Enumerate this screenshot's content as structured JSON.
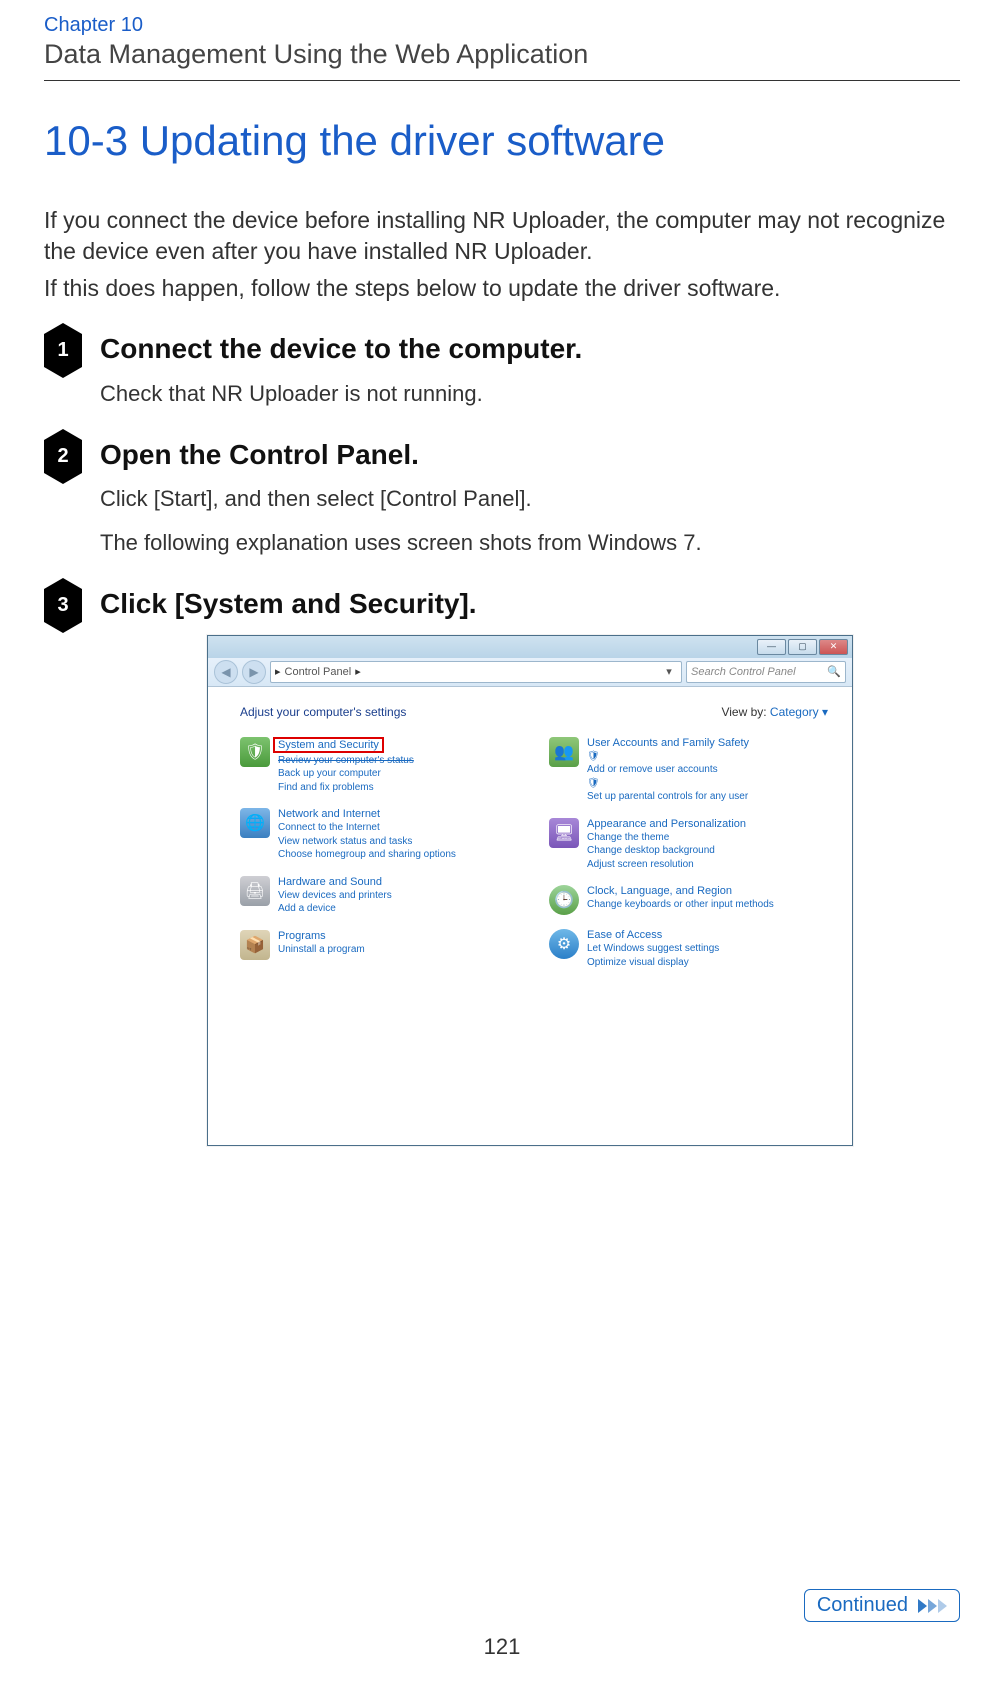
{
  "header": {
    "chapter_label": "Chapter 10",
    "chapter_title": "Data Management Using the Web Application"
  },
  "section_title": "10-3 Updating the driver software",
  "intro": [
    "If you connect the device before installing NR Uploader, the computer may not recognize the device even after you have installed NR Uploader.",
    "If this does happen, follow the steps below to update the driver software."
  ],
  "steps": [
    {
      "num": "1",
      "title": "Connect the device to the computer.",
      "desc": [
        "Check that NR Uploader is not running."
      ]
    },
    {
      "num": "2",
      "title": "Open the Control Panel.",
      "desc": [
        "Click [Start], and then select [Control Panel].",
        "The following explanation uses screen shots from Windows 7."
      ]
    },
    {
      "num": "3",
      "title": "Click [System and Security].",
      "desc": []
    }
  ],
  "win": {
    "caption_btn_min": "—",
    "caption_btn_max": "▢",
    "caption_btn_close": "✕",
    "nav_back": "◀",
    "nav_fwd": "▶",
    "addr_root": "▸",
    "addr_item": "Control Panel",
    "addr_sep": "▸",
    "addr_drop": "▾",
    "search_placeholder": "Search Control Panel",
    "search_icon": "🔍",
    "adjust_label": "Adjust your computer's settings",
    "viewby_label": "View by:",
    "viewby_value": "Category",
    "viewby_caret": "▾",
    "left_col": [
      {
        "title": "System and Security",
        "highlight": true,
        "subs": [
          "Review your computer's status",
          "Back up your computer",
          "Find and fix problems"
        ],
        "icon": "ic-green",
        "glyph": "🛡"
      },
      {
        "title": "Network and Internet",
        "subs": [
          "Connect to the Internet",
          "View network status and tasks",
          "Choose homegroup and sharing options"
        ],
        "icon": "ic-globe",
        "glyph": "🌐"
      },
      {
        "title": "Hardware and Sound",
        "subs": [
          "View devices and printers",
          "Add a device"
        ],
        "icon": "ic-hw",
        "glyph": "🖨"
      },
      {
        "title": "Programs",
        "subs": [
          "Uninstall a program"
        ],
        "icon": "ic-prog",
        "glyph": "📦"
      }
    ],
    "right_col": [
      {
        "title": "User Accounts and Family Safety",
        "subs_icon": [
          "Add or remove user accounts",
          "Set up parental controls for any user"
        ],
        "icon": "ic-user",
        "glyph": "👥"
      },
      {
        "title": "Appearance and Personalization",
        "subs": [
          "Change the theme",
          "Change desktop background",
          "Adjust screen resolution"
        ],
        "icon": "ic-appr",
        "glyph": "🖥"
      },
      {
        "title": "Clock, Language, and Region",
        "subs": [
          "Change keyboards or other input methods"
        ],
        "icon": "ic-clock",
        "glyph": "🕒"
      },
      {
        "title": "Ease of Access",
        "subs": [
          "Let Windows suggest settings",
          "Optimize visual display"
        ],
        "icon": "ic-ease",
        "glyph": "⚙"
      }
    ]
  },
  "continued_label": "Continued",
  "page_number": "121"
}
